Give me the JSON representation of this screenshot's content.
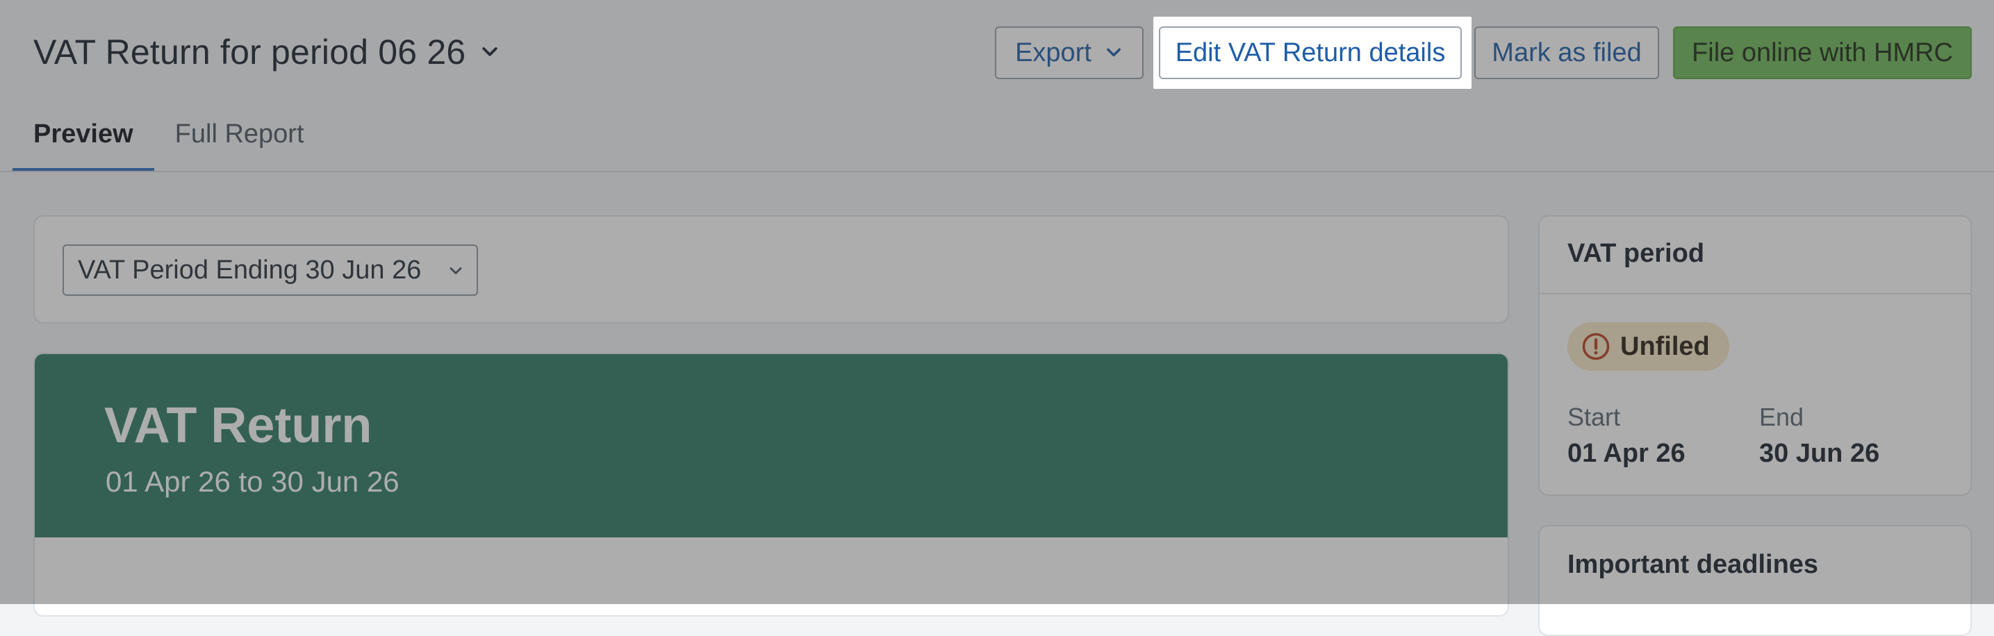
{
  "header": {
    "title": "VAT Return for period 06 26",
    "actions": {
      "export_label": "Export",
      "edit_label": "Edit VAT Return details",
      "mark_label": "Mark as filed",
      "file_label": "File online with HMRC"
    }
  },
  "tabs": [
    {
      "label": "Preview",
      "active": true
    },
    {
      "label": "Full Report",
      "active": false
    }
  ],
  "period_select": {
    "value": "VAT Period Ending 30 Jun 26"
  },
  "report": {
    "title": "VAT Return",
    "subtitle": "01 Apr 26 to 30 Jun 26"
  },
  "sidebar": {
    "vat_period": {
      "title": "VAT period",
      "status": "Unfiled",
      "start_label": "Start",
      "start_value": "01 Apr 26",
      "end_label": "End",
      "end_value": "30 Jun 26"
    },
    "deadlines": {
      "title": "Important deadlines"
    }
  },
  "colors": {
    "accent": "#2f6fc0",
    "primary_button": "#6fb95b",
    "banner": "#2d7a64",
    "badge_bg": "#f6e7c6",
    "badge_icon": "#b8401e"
  },
  "icons": {
    "title_dropdown": "chevron-down-icon",
    "export_dropdown": "chevron-down-icon",
    "select_dropdown": "chevron-down-icon",
    "status": "alert-circle-icon"
  }
}
